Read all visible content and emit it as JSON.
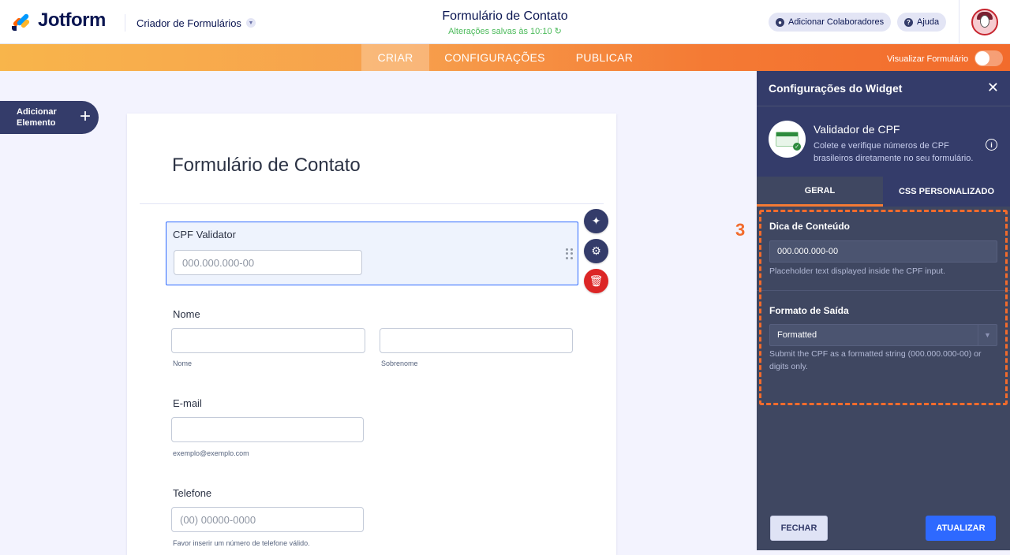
{
  "header": {
    "logo_text": "Jotform",
    "builder_menu": "Criador de Formulários",
    "form_title": "Formulário de Contato",
    "saved_status": "Alterações salvas às 10:10",
    "collab_label": "Adicionar Colaboradores",
    "help_label": "Ajuda"
  },
  "nav": {
    "tabs": [
      {
        "label": "CRIAR",
        "active": true
      },
      {
        "label": "CONFIGURAÇÕES",
        "active": false
      },
      {
        "label": "PUBLICAR",
        "active": false
      }
    ],
    "preview_label": "Visualizar Formulário",
    "preview_enabled": false
  },
  "add_element": {
    "line1": "Adicionar",
    "line2": "Elemento",
    "icon": "+"
  },
  "form": {
    "heading": "Formulário de Contato",
    "cpf": {
      "label": "CPF Validator",
      "placeholder": "000.000.000-00"
    },
    "nome": {
      "label": "Nome",
      "first_sub": "Nome",
      "last_sub": "Sobrenome"
    },
    "email": {
      "label": "E-mail",
      "sub": "exemplo@exemplo.com"
    },
    "telefone": {
      "label": "Telefone",
      "placeholder": "(00) 00000-0000",
      "sub": "Favor inserir um número de telefone válido."
    }
  },
  "panel": {
    "title": "Configurações do Widget",
    "widget_name": "Validador de CPF",
    "widget_desc": "Colete e verifique números de CPF brasileiros diretamente no seu formulário.",
    "tabs": [
      {
        "label": "GERAL",
        "active": true
      },
      {
        "label": "CSS PERSONALIZADO",
        "active": false
      }
    ],
    "hint_label": "Dica de Conteúdo",
    "hint_value": "000.000.000-00",
    "hint_help": "Placeholder text displayed inside the CPF input.",
    "format_label": "Formato de Saída",
    "format_value": "Formatted",
    "format_help": "Submit the CPF as a formatted string (000.000.000-00) or digits only.",
    "close_label": "FECHAR",
    "update_label": "ATUALIZAR"
  },
  "annotation": {
    "step_number": "3",
    "color": "#f26b2c"
  },
  "colors": {
    "accent_orange": "#f47a34",
    "primary_blue": "#2e69ff",
    "navy": "#343c6a",
    "danger": "#dc2626",
    "saved_green": "#4bba5a"
  }
}
